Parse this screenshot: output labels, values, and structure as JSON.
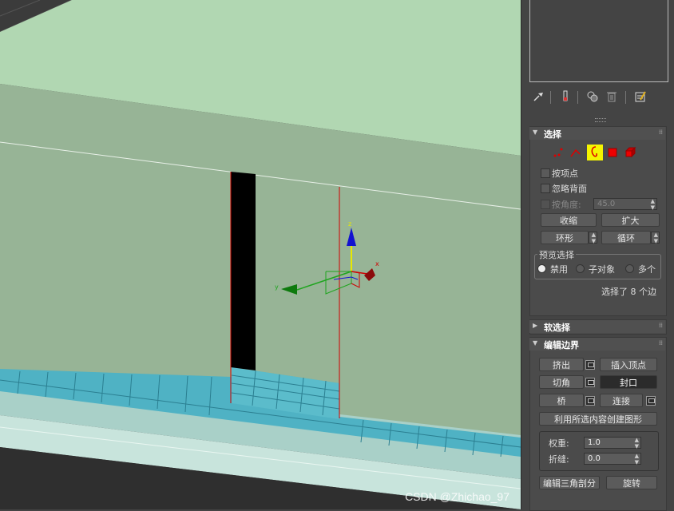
{
  "viewport": {
    "axis_x": "x",
    "axis_y": "y",
    "axis_z": "z",
    "colors": {
      "top": "#b1d7b2",
      "wall": "#97b496",
      "hole": "#000000",
      "floor_tile": "#4fb2c4",
      "edge": "#d00000"
    }
  },
  "toolbar": {
    "icons": [
      "pin-icon",
      "modifier-stack-icon",
      "show-end-result-icon",
      "make-unique-icon",
      "delete-icon",
      "configure-icon"
    ]
  },
  "selection": {
    "title": "选择",
    "by_vertex": "按项点",
    "ignore_backfacing": "忽略背面",
    "by_angle": "按角度:",
    "angle_value": "45.0",
    "shrink": "收缩",
    "grow": "扩大",
    "ring": "环形",
    "loop": "循环",
    "preview_title": "预览选择",
    "preview_off": "禁用",
    "preview_subobj": "子对象",
    "preview_multi": "多个",
    "status": "选择了 8 个边"
  },
  "soft_selection": {
    "title": "软选择"
  },
  "edit_borders": {
    "title": "编辑边界",
    "extrude": "挤出",
    "insert_vertex": "插入顶点",
    "chamfer": "切角",
    "cap": "封口",
    "bridge": "桥",
    "connect": "连接",
    "create_shape": "利用所选内容创建图形",
    "weight_label": "权重:",
    "weight_value": "1.0",
    "crease_label": "折缝:",
    "crease_value": "0.0",
    "edit_tri": "编辑三角剖分",
    "turn": "旋转"
  },
  "watermark": "CSDN @Zhichao_97"
}
